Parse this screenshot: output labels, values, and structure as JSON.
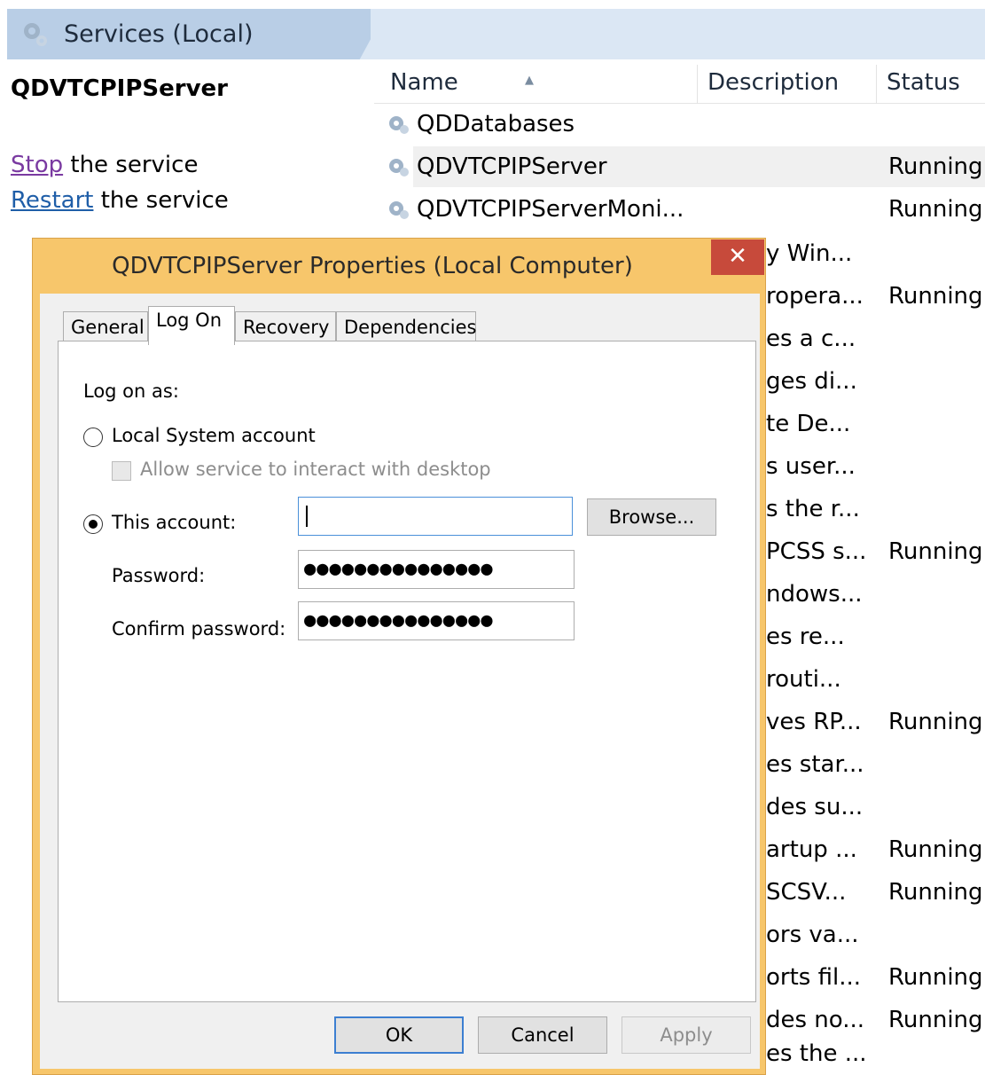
{
  "console": {
    "header_title": "Services (Local)",
    "selected_service_title": "QDVTCPIPServer",
    "actions": [
      {
        "link": "Stop",
        "rest": " the service"
      },
      {
        "link": "Restart",
        "rest": " the service"
      }
    ],
    "columns": {
      "name": "Name",
      "description": "Description",
      "status": "Status"
    },
    "rows": [
      {
        "name": "QDDatabases",
        "status": ""
      },
      {
        "name": "QDVTCPIPServer",
        "status": "Running"
      },
      {
        "name": "QDVTCPIPServerMoni...",
        "status": "Running"
      }
    ],
    "partial_rows": [
      {
        "desc": "y Win...",
        "status": ""
      },
      {
        "desc": "ropera...",
        "status": "Running"
      },
      {
        "desc": "es a c...",
        "status": ""
      },
      {
        "desc": "ges di...",
        "status": ""
      },
      {
        "desc": "te De...",
        "status": ""
      },
      {
        "desc": "s user...",
        "status": ""
      },
      {
        "desc": "s the r...",
        "status": ""
      },
      {
        "desc": "PCSS s...",
        "status": "Running"
      },
      {
        "desc": "ndows...",
        "status": ""
      },
      {
        "desc": "es re...",
        "status": ""
      },
      {
        "desc": "routi...",
        "status": ""
      },
      {
        "desc": "ves RP...",
        "status": "Running"
      },
      {
        "desc": "es star...",
        "status": ""
      },
      {
        "desc": "des su...",
        "status": ""
      },
      {
        "desc": "artup ...",
        "status": "Running"
      },
      {
        "desc": "SCSV...",
        "status": "Running"
      },
      {
        "desc": "ors va...",
        "status": ""
      },
      {
        "desc": "orts fil...",
        "status": "Running"
      },
      {
        "desc": "des no...",
        "status": "Running"
      },
      {
        "desc": "es the ...",
        "status": ""
      }
    ]
  },
  "dialog": {
    "title": "QDVTCPIPServer Properties (Local Computer)",
    "close_glyph": "✕",
    "tabs": [
      "General",
      "Log On",
      "Recovery",
      "Dependencies"
    ],
    "active_tab": "Log On",
    "log_on_as_label": "Log on as:",
    "local_system_label": "Local System account",
    "interact_desktop_label": "Allow service to interact with desktop",
    "this_account_label": "This account:",
    "this_account_value": "",
    "browse_label": "Browse...",
    "password_label": "Password:",
    "password_value": "●●●●●●●●●●●●●●●",
    "confirm_label": "Confirm password:",
    "confirm_value": "●●●●●●●●●●●●●●●",
    "ok_label": "OK",
    "cancel_label": "Cancel",
    "apply_label": "Apply"
  }
}
